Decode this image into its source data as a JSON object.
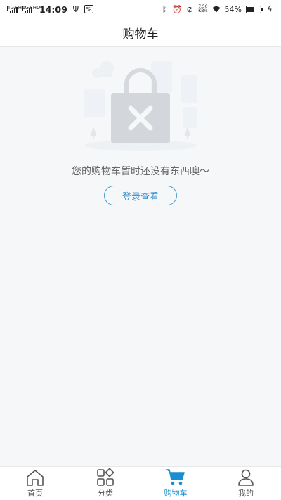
{
  "status_bar": {
    "sim1": "4G+HD",
    "sim2": "4G+HD",
    "time": "14:09",
    "speed_value": "7.50",
    "speed_unit": "KB/s",
    "battery": "54%",
    "battery_level": 0.54
  },
  "header": {
    "title": "购物车"
  },
  "empty_state": {
    "message": "您的购物车暂时还没有东西噢～",
    "login_label": "登录查看",
    "illustration_icon": "empty-bag-icon"
  },
  "bottom_nav": {
    "items": [
      {
        "label": "首页",
        "icon": "home-icon",
        "active": false
      },
      {
        "label": "分类",
        "icon": "category-icon",
        "active": false
      },
      {
        "label": "购物车",
        "icon": "cart-icon",
        "active": true
      },
      {
        "label": "我的",
        "icon": "profile-icon",
        "active": false
      }
    ],
    "active_color": "#1a8ed1",
    "inactive_color": "#555555"
  }
}
